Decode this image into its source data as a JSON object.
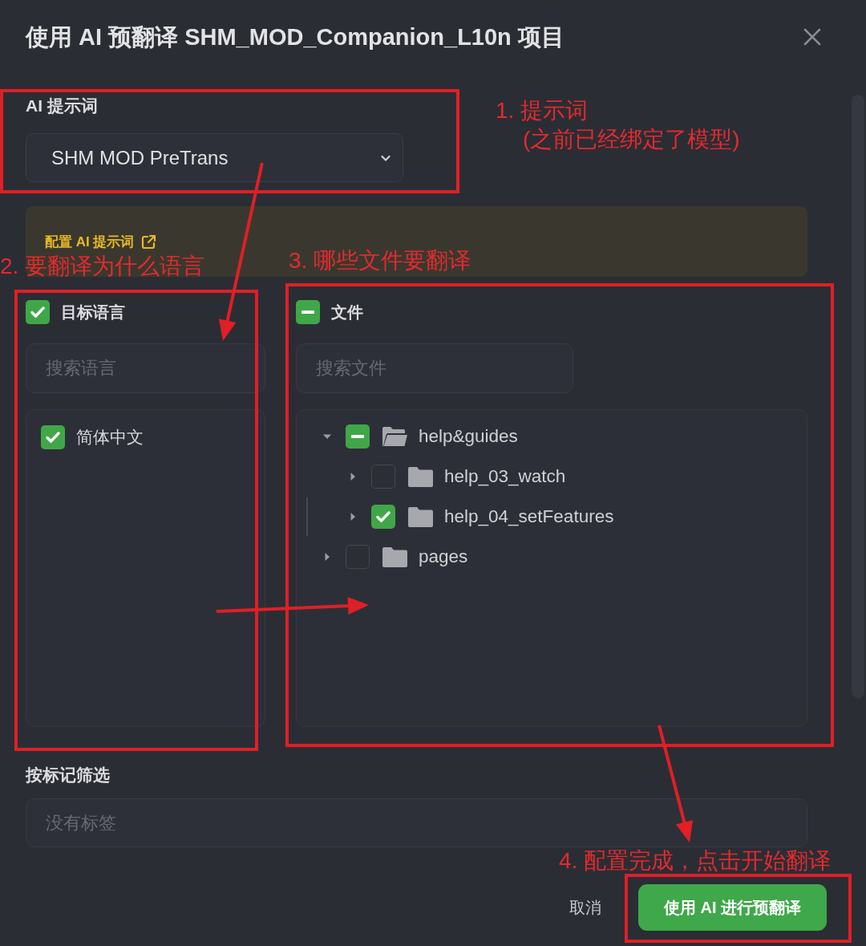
{
  "dialog": {
    "title": "使用 AI 预翻译 SHM_MOD_Companion_L10n 项目"
  },
  "prompt_section": {
    "label": "AI 提示词",
    "select_value": "SHM MOD PreTrans",
    "notice_link": "配置 AI 提示词"
  },
  "language_panel": {
    "header": {
      "label": "目标语言",
      "checked": true,
      "indeterminate": false
    },
    "search_placeholder": "搜索语言",
    "items": [
      {
        "label": "简体中文",
        "checked": true
      }
    ]
  },
  "file_panel": {
    "header": {
      "label": "文件",
      "checked": true,
      "indeterminate": true
    },
    "search_placeholder": "搜索文件",
    "tree": [
      {
        "label": "help&guides",
        "expanded": true,
        "checked": true,
        "indeterminate": true,
        "focused": false,
        "children": [
          {
            "label": "help_03_watch",
            "expanded": false,
            "checked": false,
            "indeterminate": false,
            "focused": false
          },
          {
            "label": "help_04_setFeatures",
            "expanded": false,
            "checked": true,
            "indeterminate": false,
            "focused": true
          }
        ]
      },
      {
        "label": "pages",
        "expanded": false,
        "checked": false,
        "indeterminate": false,
        "focused": false
      }
    ]
  },
  "tag_filter": {
    "label": "按标记筛选",
    "placeholder": "没有标签"
  },
  "buttons": [
    {
      "label": "取消",
      "kind": "text"
    },
    {
      "label": "使用 AI 进行预翻译",
      "kind": "primary"
    }
  ],
  "annotations": [
    {
      "lines": [
        "1. 提示词",
        "(之前已经绑定了模型)"
      ]
    },
    {
      "lines": [
        "2. 要翻译为什么语言"
      ]
    },
    {
      "lines": [
        "3. 哪些文件要翻译"
      ]
    },
    {
      "lines": [
        "4. 配置完成，点击开始翻译"
      ]
    }
  ]
}
